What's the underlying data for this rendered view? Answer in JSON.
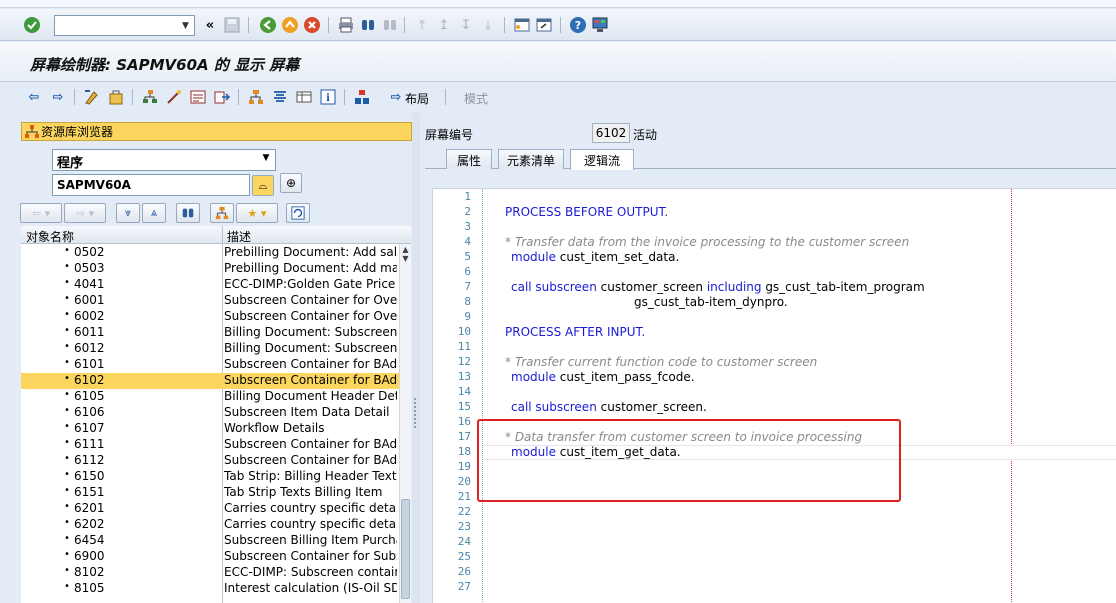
{
  "window": {
    "title": "屏幕绘制器: SAPMV60A 的 显示 屏幕"
  },
  "toolbar": {
    "command_field_value": "",
    "back_symbol": "«"
  },
  "app_toolbar": {
    "layout_label": "布局",
    "mode_label": "模式"
  },
  "repository": {
    "header": "资源库浏览器",
    "object_type": "程序",
    "object_name": "SAPMV60A",
    "col_name": "对象名称",
    "col_desc": "描述",
    "rows": [
      {
        "name": "0502",
        "desc": "Prebilling Document: Add sales"
      },
      {
        "name": "0503",
        "desc": "Prebilling Document: Add manu"
      },
      {
        "name": "4041",
        "desc": "ECC-DIMP:Golden Gate Price Pr"
      },
      {
        "name": "6001",
        "desc": "Subscreen Container for Overvi"
      },
      {
        "name": "6002",
        "desc": "Subscreen Container for Overvi"
      },
      {
        "name": "6011",
        "desc": "Billing Document: Subscreen, G"
      },
      {
        "name": "6012",
        "desc": "Billing Document: Subscreen, G"
      },
      {
        "name": "6101",
        "desc": "Subscreen Container for BAdI L"
      },
      {
        "name": "6102",
        "desc": "Subscreen Container for BAdI L"
      },
      {
        "name": "6105",
        "desc": "Billing Document Header Detail"
      },
      {
        "name": "6106",
        "desc": "Subscreen Item Data Detail"
      },
      {
        "name": "6107",
        "desc": "Workflow Details"
      },
      {
        "name": "6111",
        "desc": "Subscreen Container for BAdI L"
      },
      {
        "name": "6112",
        "desc": "Subscreen Container for BAdI L"
      },
      {
        "name": "6150",
        "desc": "Tab Strip: Billing Header Texts"
      },
      {
        "name": "6151",
        "desc": "Tab Strip Texts Billing Item"
      },
      {
        "name": "6201",
        "desc": "Carries country specific detail sc"
      },
      {
        "name": "6202",
        "desc": "Carries country specific detail sc"
      },
      {
        "name": "6454",
        "desc": "Subscreen Billing Item Purchasir"
      },
      {
        "name": "6900",
        "desc": "Subscreen Container for Subscr"
      },
      {
        "name": "8102",
        "desc": "ECC-DIMP: Subscreen container"
      },
      {
        "name": "8105",
        "desc": "Interest calculation (IS-Oil SDP"
      }
    ],
    "selected_row": "6102"
  },
  "screen": {
    "number_label": "屏幕编号",
    "number": "6102",
    "status": "活动",
    "tabs": [
      {
        "label": "属性"
      },
      {
        "label": "元素清单"
      },
      {
        "label": "逻辑流"
      }
    ],
    "active_tab": "逻辑流"
  },
  "editor": {
    "line_numbers": [
      "1",
      "2",
      "3",
      "4",
      "5",
      "6",
      "7",
      "8",
      "9",
      "10",
      "11",
      "12",
      "13",
      "14",
      "15",
      "16",
      "17",
      "18",
      "19",
      "20",
      "21",
      "22",
      "23",
      "24",
      "25",
      "26",
      "27"
    ],
    "lines": {
      "l2": "PROCESS BEFORE OUTPUT.",
      "l4": "* Transfer data from the invoice processing to the customer screen",
      "l5_kw": "module",
      "l5_id": " cust_item_set_data.",
      "l7_kw": "call subscreen",
      "l7_id": " customer_screen ",
      "l7_kw2": "including",
      "l7_id2": " gs_cust_tab-item_program",
      "l8_id": "gs_cust_tab-item_dynpro.",
      "l10": "PROCESS AFTER INPUT.",
      "l12": "* Transfer current function code to customer screen",
      "l13_kw": "module",
      "l13_id": " cust_item_pass_fcode.",
      "l15_kw": "call subscreen",
      "l15_id": " customer_screen.",
      "l17": "* Data transfer from customer screen to invoice processing",
      "l18_kw": "module",
      "l18_id": " cust_item_get_data."
    }
  },
  "colors": {
    "keyword": "#1a1ad6",
    "comment": "#8a8a8a",
    "selection": "#fbd55e",
    "annotation_box": "#e02020"
  }
}
